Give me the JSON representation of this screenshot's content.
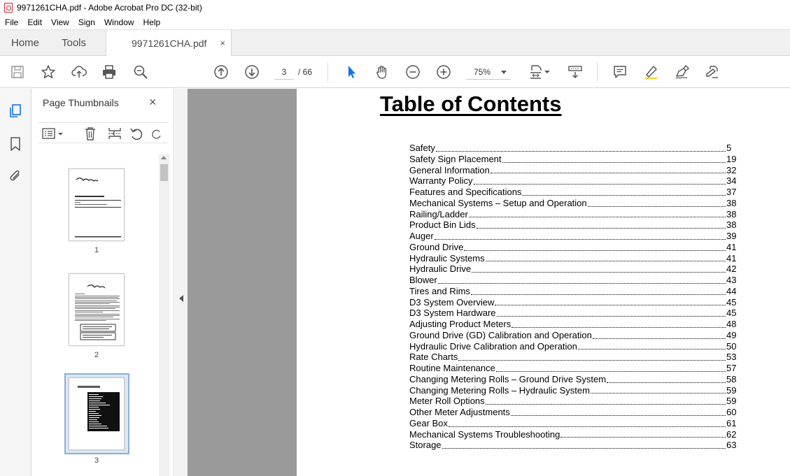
{
  "window": {
    "title": "9971261CHA.pdf - Adobe Acrobat Pro DC (32-bit)"
  },
  "menu": [
    "File",
    "Edit",
    "View",
    "Sign",
    "Window",
    "Help"
  ],
  "tabs": {
    "home": "Home",
    "tools": "Tools",
    "document": "9971261CHA.pdf",
    "close": "×"
  },
  "toolbar": {
    "current_page": "3",
    "page_total": "/  66",
    "zoom": "75%"
  },
  "thumbnails_panel": {
    "title": "Page Thumbnails",
    "close": "×",
    "pages": [
      {
        "number": "1"
      },
      {
        "number": "2"
      },
      {
        "number": "3"
      }
    ],
    "selected_page": "3"
  },
  "document": {
    "title": "Table of Contents",
    "toc": [
      {
        "title": "Safety",
        "page": "5"
      },
      {
        "title": "Safety Sign Placement",
        "page": "19"
      },
      {
        "title": "General Information",
        "page": "32"
      },
      {
        "title": "Warranty Policy",
        "page": "34"
      },
      {
        "title": "Features and Specifications",
        "page": "37"
      },
      {
        "title": "Mechanical Systems – Setup and Operation",
        "page": "38"
      },
      {
        "title": "Railing/Ladder",
        "page": "38"
      },
      {
        "title": "Product Bin Lids",
        "page": "38"
      },
      {
        "title": "Auger",
        "page": "39"
      },
      {
        "title": "Ground Drive",
        "page": "41"
      },
      {
        "title": "Hydraulic Systems",
        "page": "41"
      },
      {
        "title": "Hydraulic Drive",
        "page": "42"
      },
      {
        "title": "Blower",
        "page": "43"
      },
      {
        "title": "Tires and Rims",
        "page": "44"
      },
      {
        "title": "D3 System Overview",
        "page": "45"
      },
      {
        "title": "D3 System Hardware",
        "page": "45"
      },
      {
        "title": "Adjusting Product Meters",
        "page": "48"
      },
      {
        "title": "Ground Drive (GD) Calibration and Operation",
        "page": "49"
      },
      {
        "title": "Hydraulic Drive Calibration and Operation",
        "page": "50"
      },
      {
        "title": "Rate Charts",
        "page": "53"
      },
      {
        "title": "Routine Maintenance",
        "page": "57"
      },
      {
        "title": "Changing Metering Rolls – Ground Drive System",
        "page": "58"
      },
      {
        "title": "Changing Metering Rolls – Hydraulic System",
        "page": "59"
      },
      {
        "title": "Meter Roll Options",
        "page": "59"
      },
      {
        "title": "Other Meter Adjustments",
        "page": "60"
      },
      {
        "title": "Gear Box",
        "page": "61"
      },
      {
        "title": "Mechanical Systems Troubleshooting",
        "page": "62"
      },
      {
        "title": "Storage",
        "page": "63"
      }
    ]
  },
  "colors": {
    "accent": "#1473e6",
    "doc_background": "#9a9a9a",
    "pdf_icon": "#d8262b"
  }
}
